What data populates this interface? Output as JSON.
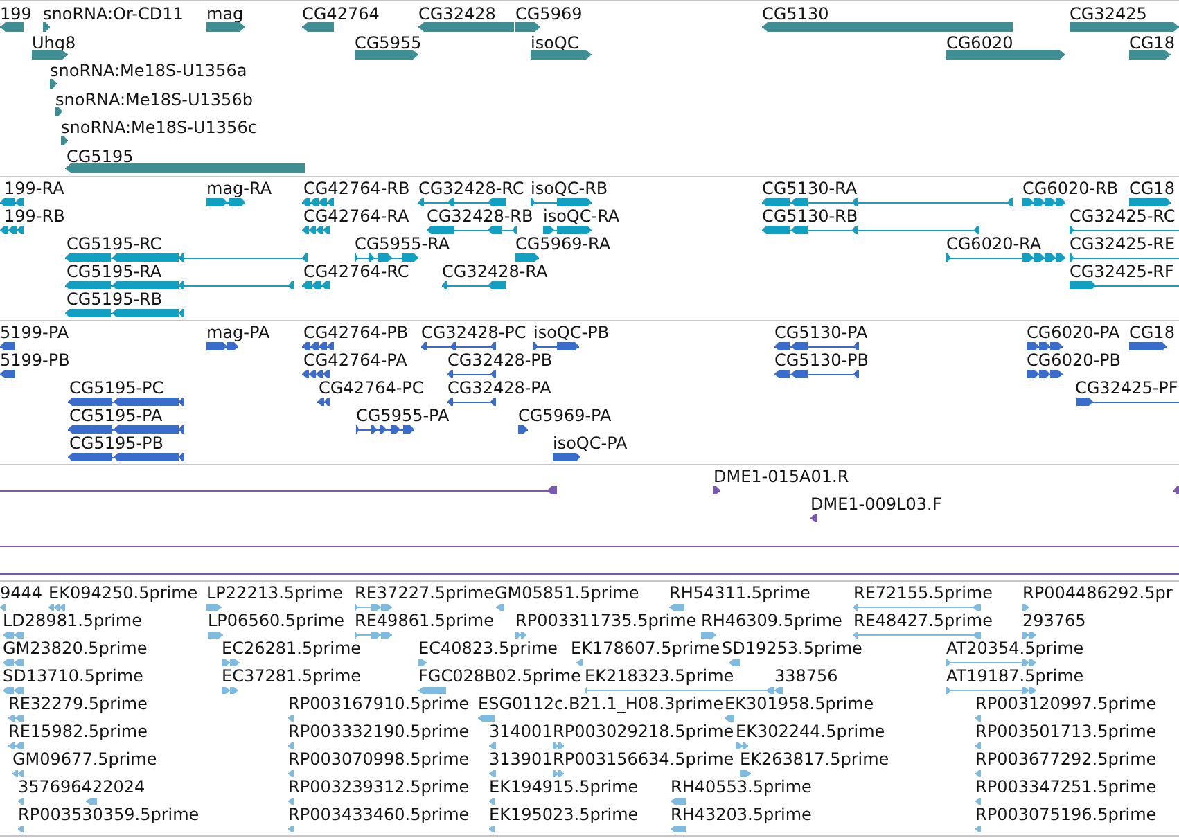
{
  "tracks": [
    {
      "kind": "gene",
      "color": "#3e8e94",
      "features": [
        {
          "label": "199",
          "reverse": true
        },
        {
          "label": "snoRNA:Or-CD11",
          "reverse": false
        },
        {
          "label": "mag",
          "reverse": false
        },
        {
          "label": "CG42764",
          "reverse": true
        },
        {
          "label": "CG32428",
          "reverse": true
        },
        {
          "label": "CG5969",
          "reverse": false
        },
        {
          "label": "CG5130",
          "reverse": true
        },
        {
          "label": "CG32425",
          "reverse": false
        },
        {
          "label": "Uhg8",
          "reverse": false
        },
        {
          "label": "CG5955",
          "reverse": false
        },
        {
          "label": "isoQC",
          "reverse": false
        },
        {
          "label": "CG6020",
          "reverse": false
        },
        {
          "label": "CG18",
          "reverse": false
        },
        {
          "label": "snoRNA:Me18S-U1356a",
          "reverse": false
        },
        {
          "label": "snoRNA:Me18S-U1356b",
          "reverse": false
        },
        {
          "label": "snoRNA:Me18S-U1356c",
          "reverse": false
        },
        {
          "label": "CG5195",
          "reverse": true
        }
      ]
    },
    {
      "kind": "transcript",
      "color": "#11a0c1",
      "features": [
        {
          "label": "199-RA",
          "reverse": true
        },
        {
          "label": "mag-RA",
          "reverse": false
        },
        {
          "label": "CG42764-RB",
          "reverse": true
        },
        {
          "label": "CG32428-RC",
          "reverse": true
        },
        {
          "label": "isoQC-RB",
          "reverse": false
        },
        {
          "label": "CG5130-RA",
          "reverse": true
        },
        {
          "label": "CG6020-RB",
          "reverse": false
        },
        {
          "label": "CG18",
          "reverse": false
        },
        {
          "label": "199-RB",
          "reverse": true
        },
        {
          "label": "CG42764-RA",
          "reverse": true
        },
        {
          "label": "CG32428-RB",
          "reverse": true
        },
        {
          "label": "isoQC-RA",
          "reverse": false
        },
        {
          "label": "CG5130-RB",
          "reverse": true
        },
        {
          "label": "CG32425-RC",
          "reverse": false
        },
        {
          "label": "CG5195-RC",
          "reverse": true
        },
        {
          "label": "CG5955-RA",
          "reverse": false
        },
        {
          "label": "CG5969-RA",
          "reverse": false
        },
        {
          "label": "CG6020-RA",
          "reverse": false
        },
        {
          "label": "CG32425-RE",
          "reverse": false
        },
        {
          "label": "CG5195-RA",
          "reverse": true
        },
        {
          "label": "CG42764-RC",
          "reverse": true
        },
        {
          "label": "CG32428-RA",
          "reverse": true
        },
        {
          "label": "CG32425-RF",
          "reverse": false
        },
        {
          "label": "CG5195-RB",
          "reverse": true
        }
      ]
    },
    {
      "kind": "protein",
      "color": "#3a6ccc",
      "features": [
        {
          "label": "5199-PA",
          "reverse": true
        },
        {
          "label": "mag-PA",
          "reverse": false
        },
        {
          "label": "CG42764-PB",
          "reverse": true
        },
        {
          "label": "CG32428-PC",
          "reverse": true
        },
        {
          "label": "isoQC-PB",
          "reverse": false
        },
        {
          "label": "CG5130-PA",
          "reverse": true
        },
        {
          "label": "CG6020-PA",
          "reverse": false
        },
        {
          "label": "CG18",
          "reverse": false
        },
        {
          "label": "5199-PB",
          "reverse": true
        },
        {
          "label": "CG42764-PA",
          "reverse": true
        },
        {
          "label": "CG32428-PB",
          "reverse": true
        },
        {
          "label": "CG5130-PB",
          "reverse": true
        },
        {
          "label": "CG6020-PB",
          "reverse": false
        },
        {
          "label": "CG5195-PC",
          "reverse": true
        },
        {
          "label": "CG42764-PC",
          "reverse": true
        },
        {
          "label": "CG32428-PA",
          "reverse": true
        },
        {
          "label": "CG32425-PF",
          "reverse": false
        },
        {
          "label": "CG5195-PA",
          "reverse": true
        },
        {
          "label": "CG5955-PA",
          "reverse": false
        },
        {
          "label": "CG5969-PA",
          "reverse": false
        },
        {
          "label": "CG5195-PB",
          "reverse": true
        },
        {
          "label": "isoQC-PA",
          "reverse": false
        }
      ]
    },
    {
      "kind": "clone",
      "color": "#7a58b4",
      "features": [
        {
          "kind": "read",
          "reverse": true
        },
        {
          "kind": "read",
          "label": "DME1-015A01.R",
          "reverse": false
        },
        {
          "kind": "read",
          "reverse": true
        },
        {
          "kind": "read",
          "label": "DME1-009L03.F",
          "reverse": true
        },
        {
          "kind": "span"
        },
        {
          "kind": "span"
        }
      ]
    },
    {
      "kind": "est",
      "color": "#7fbbe0",
      "features": [
        {
          "label": "9444",
          "reverse": true
        },
        {
          "label": "EK094250.5prime",
          "reverse": true
        },
        {
          "label": "LP22213.5prime",
          "reverse": false
        },
        {
          "label": "RE37227.5prime",
          "reverse": false
        },
        {
          "label": "GM05851.5prime",
          "reverse": true
        },
        {
          "label": "RH54311.5prime",
          "reverse": true
        },
        {
          "label": "RE72155.5prime",
          "reverse": true
        },
        {
          "label": "RP004486292.5pr",
          "reverse": false
        },
        {
          "label": "LD28981.5prime",
          "reverse": true
        },
        {
          "label": "LP06560.5prime",
          "reverse": false
        },
        {
          "label": "RE49861.5prime",
          "reverse": false
        },
        {
          "label": "RP003311735.5prime",
          "reverse": false
        },
        {
          "label": "RH46309.5prime",
          "reverse": false
        },
        {
          "label": "RE48427.5prime",
          "reverse": true
        },
        {
          "label": "293765",
          "reverse": false
        },
        {
          "label": "GM23820.5prime",
          "reverse": true
        },
        {
          "label": "EC26281.5prime",
          "reverse": false
        },
        {
          "label": "EC40823.5prime",
          "reverse": false
        },
        {
          "label": "EK178607.5prime",
          "reverse": true
        },
        {
          "label": "SD19253.5prime",
          "reverse": true
        },
        {
          "label": "AT20354.5prime",
          "reverse": false
        },
        {
          "label": "SD13710.5prime",
          "reverse": true
        },
        {
          "label": "EC37281.5prime",
          "reverse": false
        },
        {
          "label": "FGC028B02.5prime",
          "reverse": true
        },
        {
          "label": "EK218323.5prime",
          "reverse": true
        },
        {
          "label": "338756",
          "reverse": true
        },
        {
          "label": "AT19187.5prime",
          "reverse": false
        },
        {
          "label": "RE32279.5prime",
          "reverse": true
        },
        {
          "label": "RP003167910.5prime",
          "reverse": true
        },
        {
          "label": "ESG0112c.B21.1_H08.3prime",
          "reverse": true
        },
        {
          "label": "EK301958.5prime",
          "reverse": true
        },
        {
          "label": "RP003120997.5prime",
          "reverse": true
        },
        {
          "label": "RE15982.5prime",
          "reverse": true
        },
        {
          "label": "RP003332190.5prime",
          "reverse": true
        },
        {
          "label": "314001",
          "reverse": true
        },
        {
          "label": "RP003029218.5prime",
          "reverse": false
        },
        {
          "label": "EK302244.5prime",
          "reverse": false
        },
        {
          "label": "RP003501713.5prime",
          "reverse": true
        },
        {
          "label": "GM09677.5prime",
          "reverse": true
        },
        {
          "label": "RP003070998.5prime",
          "reverse": true
        },
        {
          "label": "313901",
          "reverse": true
        },
        {
          "label": "RP003156634.5prime",
          "reverse": false
        },
        {
          "label": "EK263817.5prime",
          "reverse": false
        },
        {
          "label": "RP003677292.5prime",
          "reverse": true
        },
        {
          "label": "357696422024",
          "reverse": true
        },
        {
          "reverse": true
        },
        {
          "label": "RP003239312.5prime",
          "reverse": true
        },
        {
          "label": "EK194915.5prime",
          "reverse": true
        },
        {
          "label": "RH40553.5prime",
          "reverse": true
        },
        {
          "label": "RP003347251.5prime",
          "reverse": true
        },
        {
          "label": "RP003530359.5prime",
          "reverse": true
        },
        {
          "label": "RP003433460.5prime",
          "reverse": true
        },
        {
          "label": "EK195023.5prime",
          "reverse": true
        },
        {
          "label": "RH43203.5prime",
          "reverse": true
        },
        {
          "label": "RP003075196.5prime",
          "reverse": true
        }
      ]
    }
  ]
}
